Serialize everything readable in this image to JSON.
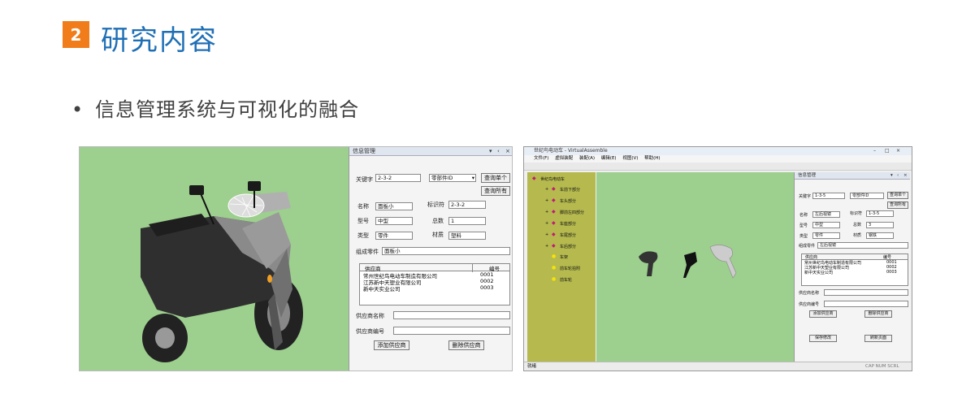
{
  "section": {
    "number": "2",
    "title": "研究内容"
  },
  "bullet": {
    "dot": "•",
    "text": "信息管理系统与可视化的融合"
  },
  "left": {
    "panel_title": "信息管理",
    "panel_buttons": [
      "▾",
      "‹",
      "×"
    ],
    "keyword_label": "关键字",
    "keyword_value": "2-3-2",
    "field_select": "零部件ID",
    "query_one": "查询单个",
    "query_all": "查询所有",
    "name_label": "名称",
    "name_value": "面板小",
    "idsym_label": "标识符",
    "idsym_value": "2-3-2",
    "model_label": "型号",
    "model_value": "中型",
    "total_label": "总数",
    "total_value": "1",
    "type_label": "类型",
    "type_value": "零件",
    "material_label": "材质",
    "material_value": "塑料",
    "assembly_label": "组成零件",
    "assembly_value": "面板小",
    "table": {
      "headers": [
        "供应商",
        "编号"
      ],
      "rows": [
        [
          "常州世纪鸟电动车制造有限公司",
          "0001"
        ],
        [
          "江苏新中天塑业有限公司",
          "0002"
        ],
        [
          "新中天实业公司",
          "0003"
        ]
      ]
    },
    "supplier_name_label": "供应商名称",
    "supplier_no_label": "供应商编号",
    "add_button": "添加供应商",
    "delete_button": "删除供应商"
  },
  "right": {
    "window_title": "世纪鸟电动车 - VirtualAssemble",
    "window_buttons": [
      "–",
      "□",
      "×"
    ],
    "menu": [
      "文件(F)",
      "虚拟装配",
      "装配(A)",
      "编辑(E)",
      "视图(V)",
      "帮助(H)"
    ],
    "tree_root": "世纪鸟电动车",
    "tree_items": [
      "车前下部分",
      "车头部分",
      "脚前左四部分",
      "车座部分",
      "车尾部分",
      "车后部分"
    ],
    "tree_leaves": [
      "车架",
      "前车轮拍附",
      "前车轮"
    ],
    "panel_title": "信息管理",
    "panel_buttons": [
      "▾",
      "‹",
      "×"
    ],
    "keyword_label": "关键字",
    "keyword_value": "1-3-5",
    "field_select": "零部件ID",
    "query_one": "查询单个",
    "query_all": "查询所有",
    "name_label": "名称",
    "name_value": "左后视镜",
    "idsym_label": "标识符",
    "idsym_value": "1-3-5",
    "model_label": "型号",
    "model_value": "中型",
    "total_label": "总数",
    "total_value": "3",
    "type_label": "类型",
    "type_value": "零件",
    "material_label": "材质",
    "material_value": "钢铁",
    "assembly_label": "组成零件",
    "assembly_value": "左后视镜",
    "table": {
      "headers": [
        "供应商",
        "编号"
      ],
      "rows": [
        [
          "常州世纪鸟电动车制造有限公司",
          "0001"
        ],
        [
          "江苏新中天塑业有限公司",
          "0002"
        ],
        [
          "新中天实业公司",
          "0003"
        ]
      ]
    },
    "supplier_name_label": "供应商名称",
    "supplier_no_label": "供应商编号",
    "add_button": "添加供应商",
    "delete_button": "删除供应商",
    "save_button": "保存修改",
    "refresh_button": "刷新页面",
    "status_left": "就绪",
    "status_right": "CAP NUM SCRL"
  },
  "colors": {
    "accent": "#f07c1a",
    "title": "#1f6fb5",
    "scene": "#9dcf8e",
    "tree": "#b5b94e"
  }
}
